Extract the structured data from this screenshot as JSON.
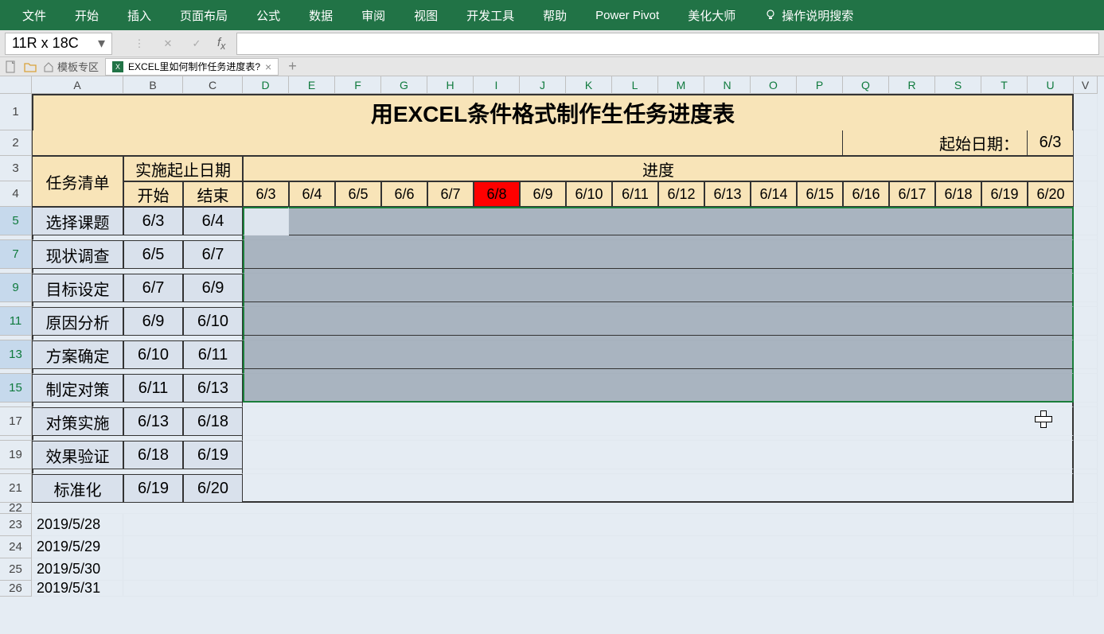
{
  "ribbon": {
    "items": [
      "文件",
      "开始",
      "插入",
      "页面布局",
      "公式",
      "数据",
      "审阅",
      "视图",
      "开发工具",
      "帮助",
      "Power Pivot",
      "美化大师"
    ],
    "tell_me": "操作说明搜索"
  },
  "formula_bar": {
    "name_box": "11R x 18C"
  },
  "tabs": {
    "template": "模板专区",
    "doc_name": "EXCEL里如何制作任务进度表?"
  },
  "columns": [
    "A",
    "B",
    "C",
    "D",
    "E",
    "F",
    "G",
    "H",
    "I",
    "J",
    "K",
    "L",
    "M",
    "N",
    "O",
    "P",
    "Q",
    "R",
    "S",
    "T",
    "U",
    "V"
  ],
  "rows": [
    "1",
    "2",
    "3",
    "4",
    "5",
    "7",
    "9",
    "11",
    "13",
    "15",
    "17",
    "19",
    "21",
    "22",
    "23",
    "24",
    "25",
    "26"
  ],
  "sheet": {
    "title": "用EXCEL条件格式制作生任务进度表",
    "start_date_label": "起始日期：",
    "start_date_value": "6/3",
    "task_list_header": "任务清单",
    "date_range_header": "实施起止日期",
    "start_header": "开始",
    "end_header": "结束",
    "progress_header": "进度",
    "dates": [
      "6/3",
      "6/4",
      "6/5",
      "6/6",
      "6/7",
      "6/8",
      "6/9",
      "6/10",
      "6/11",
      "6/12",
      "6/13",
      "6/14",
      "6/15",
      "6/16",
      "6/17",
      "6/18",
      "6/19",
      "6/20"
    ],
    "highlight_date_index": 5,
    "tasks": [
      {
        "name": "选择课题",
        "start": "6/3",
        "end": "6/4"
      },
      {
        "name": "现状调查",
        "start": "6/5",
        "end": "6/7"
      },
      {
        "name": "目标设定",
        "start": "6/7",
        "end": "6/9"
      },
      {
        "name": "原因分析",
        "start": "6/9",
        "end": "6/10"
      },
      {
        "name": "方案确定",
        "start": "6/10",
        "end": "6/11"
      },
      {
        "name": "制定对策",
        "start": "6/11",
        "end": "6/13"
      },
      {
        "name": "对策实施",
        "start": "6/13",
        "end": "6/18"
      },
      {
        "name": "效果验证",
        "start": "6/18",
        "end": "6/19"
      },
      {
        "name": "标准化",
        "start": "6/19",
        "end": "6/20"
      }
    ],
    "extra_dates": [
      "2019/5/28",
      "2019/5/29",
      "2019/5/30",
      "2019/5/31"
    ]
  }
}
